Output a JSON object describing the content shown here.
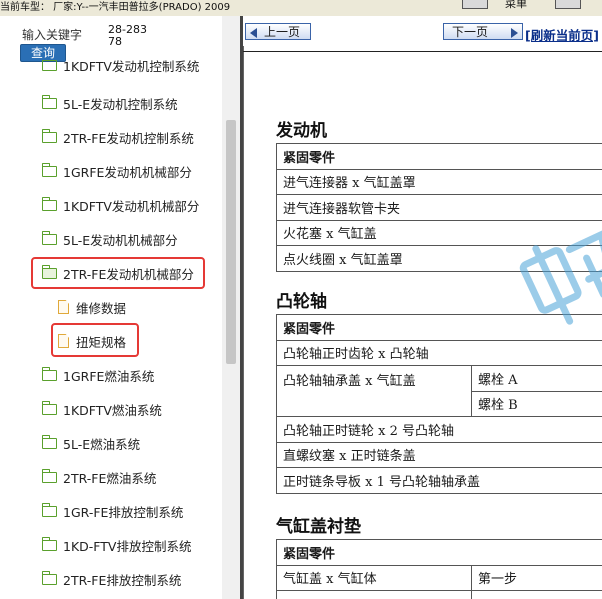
{
  "topbar": {
    "vehicle_label": "当前车型： 厂家:Y--一汽丰田普拉多(PRADO) 2009",
    "menu_label": "菜单"
  },
  "search": {
    "label": "输入关键字",
    "value": "28-28378",
    "button": "查询"
  },
  "tree": {
    "partial_top": "1KDFTV发动机控制系统",
    "items": [
      {
        "label": "5L-E发动机控制系统"
      },
      {
        "label": "2TR-FE发动机控制系统"
      },
      {
        "label": "1GRFE发动机机械部分"
      },
      {
        "label": "1KDFTV发动机机械部分"
      },
      {
        "label": "5L-E发动机机械部分"
      },
      {
        "label": "2TR-FE发动机机械部分"
      },
      {
        "label": "维修数据"
      },
      {
        "label": "扭矩规格"
      },
      {
        "label": "1GRFE燃油系统"
      },
      {
        "label": "1KDFTV燃油系统"
      },
      {
        "label": "5L-E燃油系统"
      },
      {
        "label": "2TR-FE燃油系统"
      },
      {
        "label": "1GR-FE排放控制系统"
      },
      {
        "label": "1KD-FTV排放控制系统"
      },
      {
        "label": "2TR-FE排放控制系统"
      }
    ]
  },
  "nav": {
    "prev": "上一页",
    "next": "下一页",
    "refresh": "[刷新当前页]"
  },
  "doc": {
    "sections": [
      {
        "title": "发动机",
        "header": "紧固零件",
        "rows": [
          "进气连接器 x 气缸盖罩",
          "进气连接器软管卡夹",
          "火花塞 x 气缸盖",
          "点火线圈 x 气缸盖罩"
        ]
      },
      {
        "title": "凸轮轴",
        "header": "紧固零件",
        "rows": [
          "凸轮轴正时齿轮 x 凸轮轴",
          "凸轮轴轴承盖 x 气缸盖",
          "螺栓 A",
          "螺栓 B",
          "凸轮轴正时链轮 x 2 号凸轮轴",
          "直螺纹塞 x 正时链条盖",
          "正时链条导板 x 1 号凸轮轴轴承盖"
        ]
      },
      {
        "title": "气缸盖衬垫",
        "header": "紧固零件",
        "rows": [
          "气缸盖 x 气缸体",
          "第一步"
        ]
      }
    ]
  },
  "colors": {
    "highlight": "#e53935",
    "folder": "#5aa02c",
    "document": "#e0a93a",
    "query_button": "#2a6fb5"
  }
}
